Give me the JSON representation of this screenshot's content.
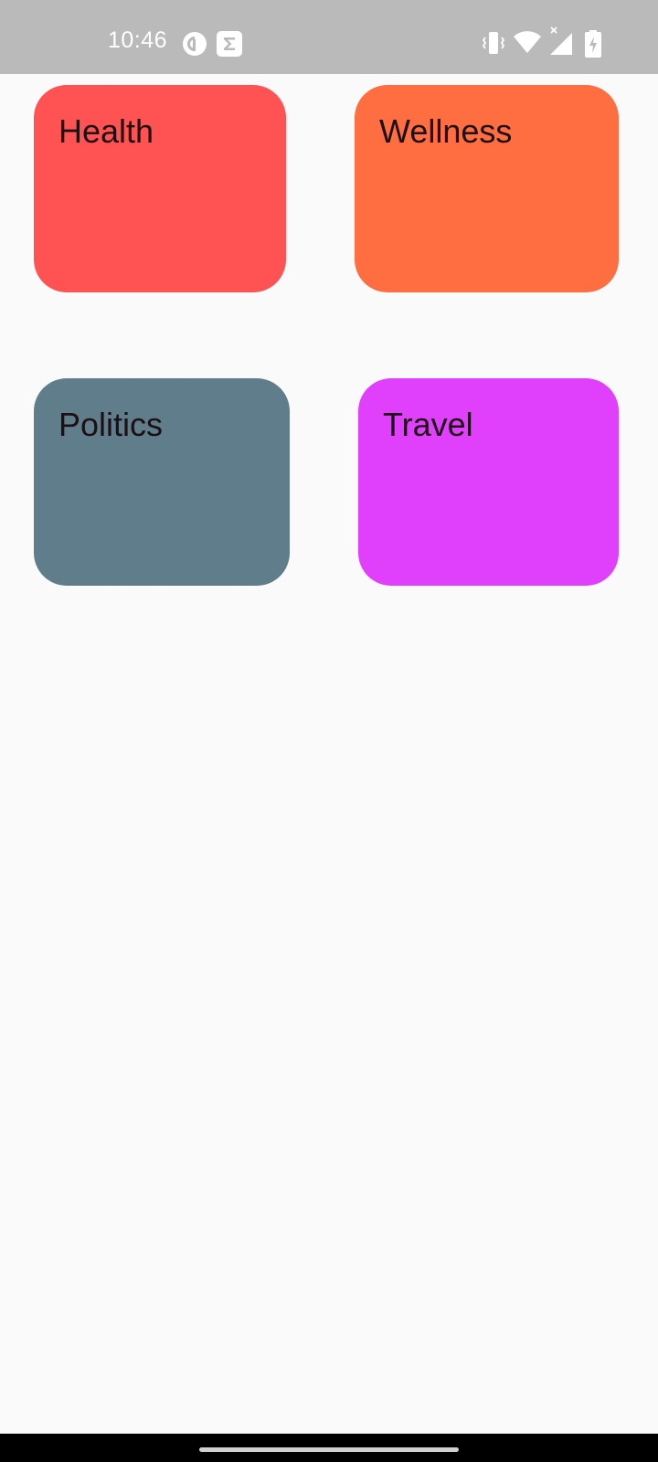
{
  "status_bar": {
    "time": "10:46",
    "notification_icons": [
      "pocket-casts-icon",
      "sigma-app-icon"
    ],
    "system_icons": [
      "vibrate-icon",
      "wifi-icon",
      "cellular-signal-icon",
      "battery-charging-icon"
    ]
  },
  "categories": [
    {
      "label": "Health",
      "color": "#ff5252"
    },
    {
      "label": "Wellness",
      "color": "#ff6e40"
    },
    {
      "label": "Politics",
      "color": "#607d8b"
    },
    {
      "label": "Travel",
      "color": "#e040fb"
    }
  ]
}
